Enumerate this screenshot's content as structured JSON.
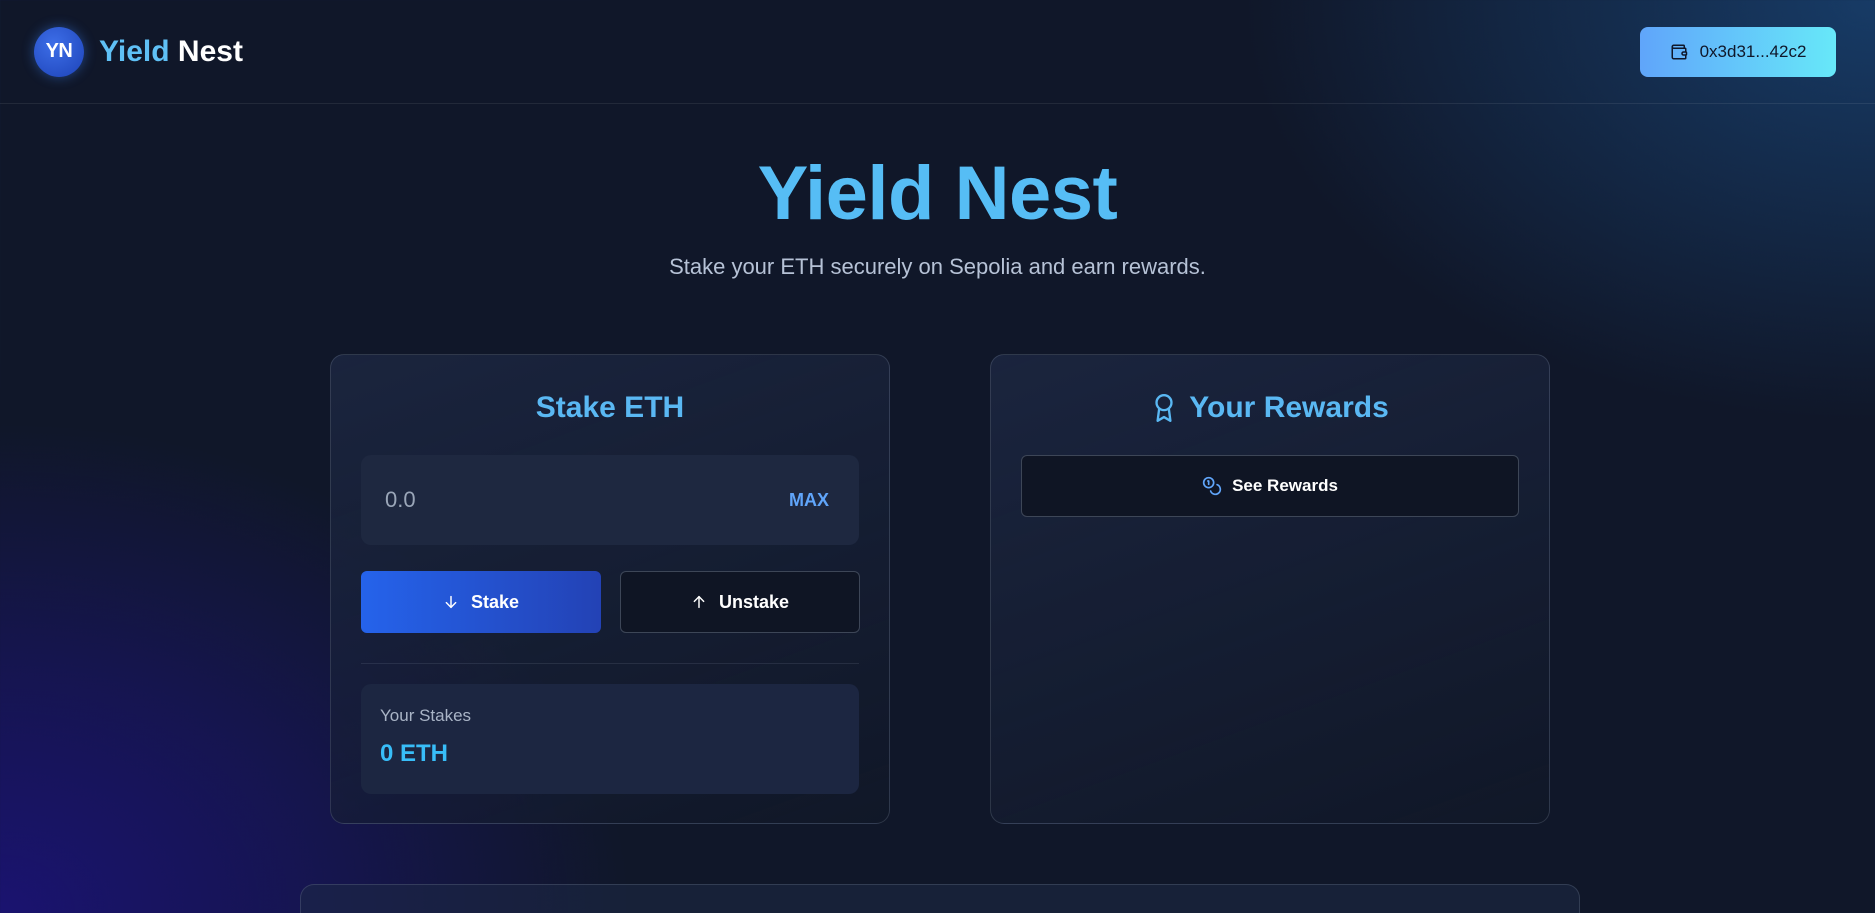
{
  "header": {
    "logo_initials": "YN",
    "brand_first": "Yield",
    "brand_second": "Nest",
    "wallet_address": "0x3d31...42c2",
    "wallet_icon": "wallet-icon"
  },
  "hero": {
    "title": "Yield Nest",
    "subtitle": "Stake your ETH securely on Sepolia and earn rewards."
  },
  "stake_card": {
    "title": "Stake ETH",
    "amount_placeholder": "0.0",
    "max_label": "MAX",
    "stake_label": "Stake",
    "stake_icon": "arrow-down-icon",
    "unstake_label": "Unstake",
    "unstake_icon": "arrow-up-icon",
    "stakes_label": "Your Stakes",
    "stakes_value": "0 ETH"
  },
  "rewards_card": {
    "title": "Your Rewards",
    "title_icon": "award-icon",
    "see_rewards_label": "See Rewards",
    "see_rewards_icon": "coins-icon"
  },
  "colors": {
    "accent": "#56bdf5",
    "primary_button": "#2563eb",
    "wallet_gradient_start": "#60a5fa",
    "wallet_gradient_end": "#67e8f9",
    "value_text": "#38bdf8"
  }
}
